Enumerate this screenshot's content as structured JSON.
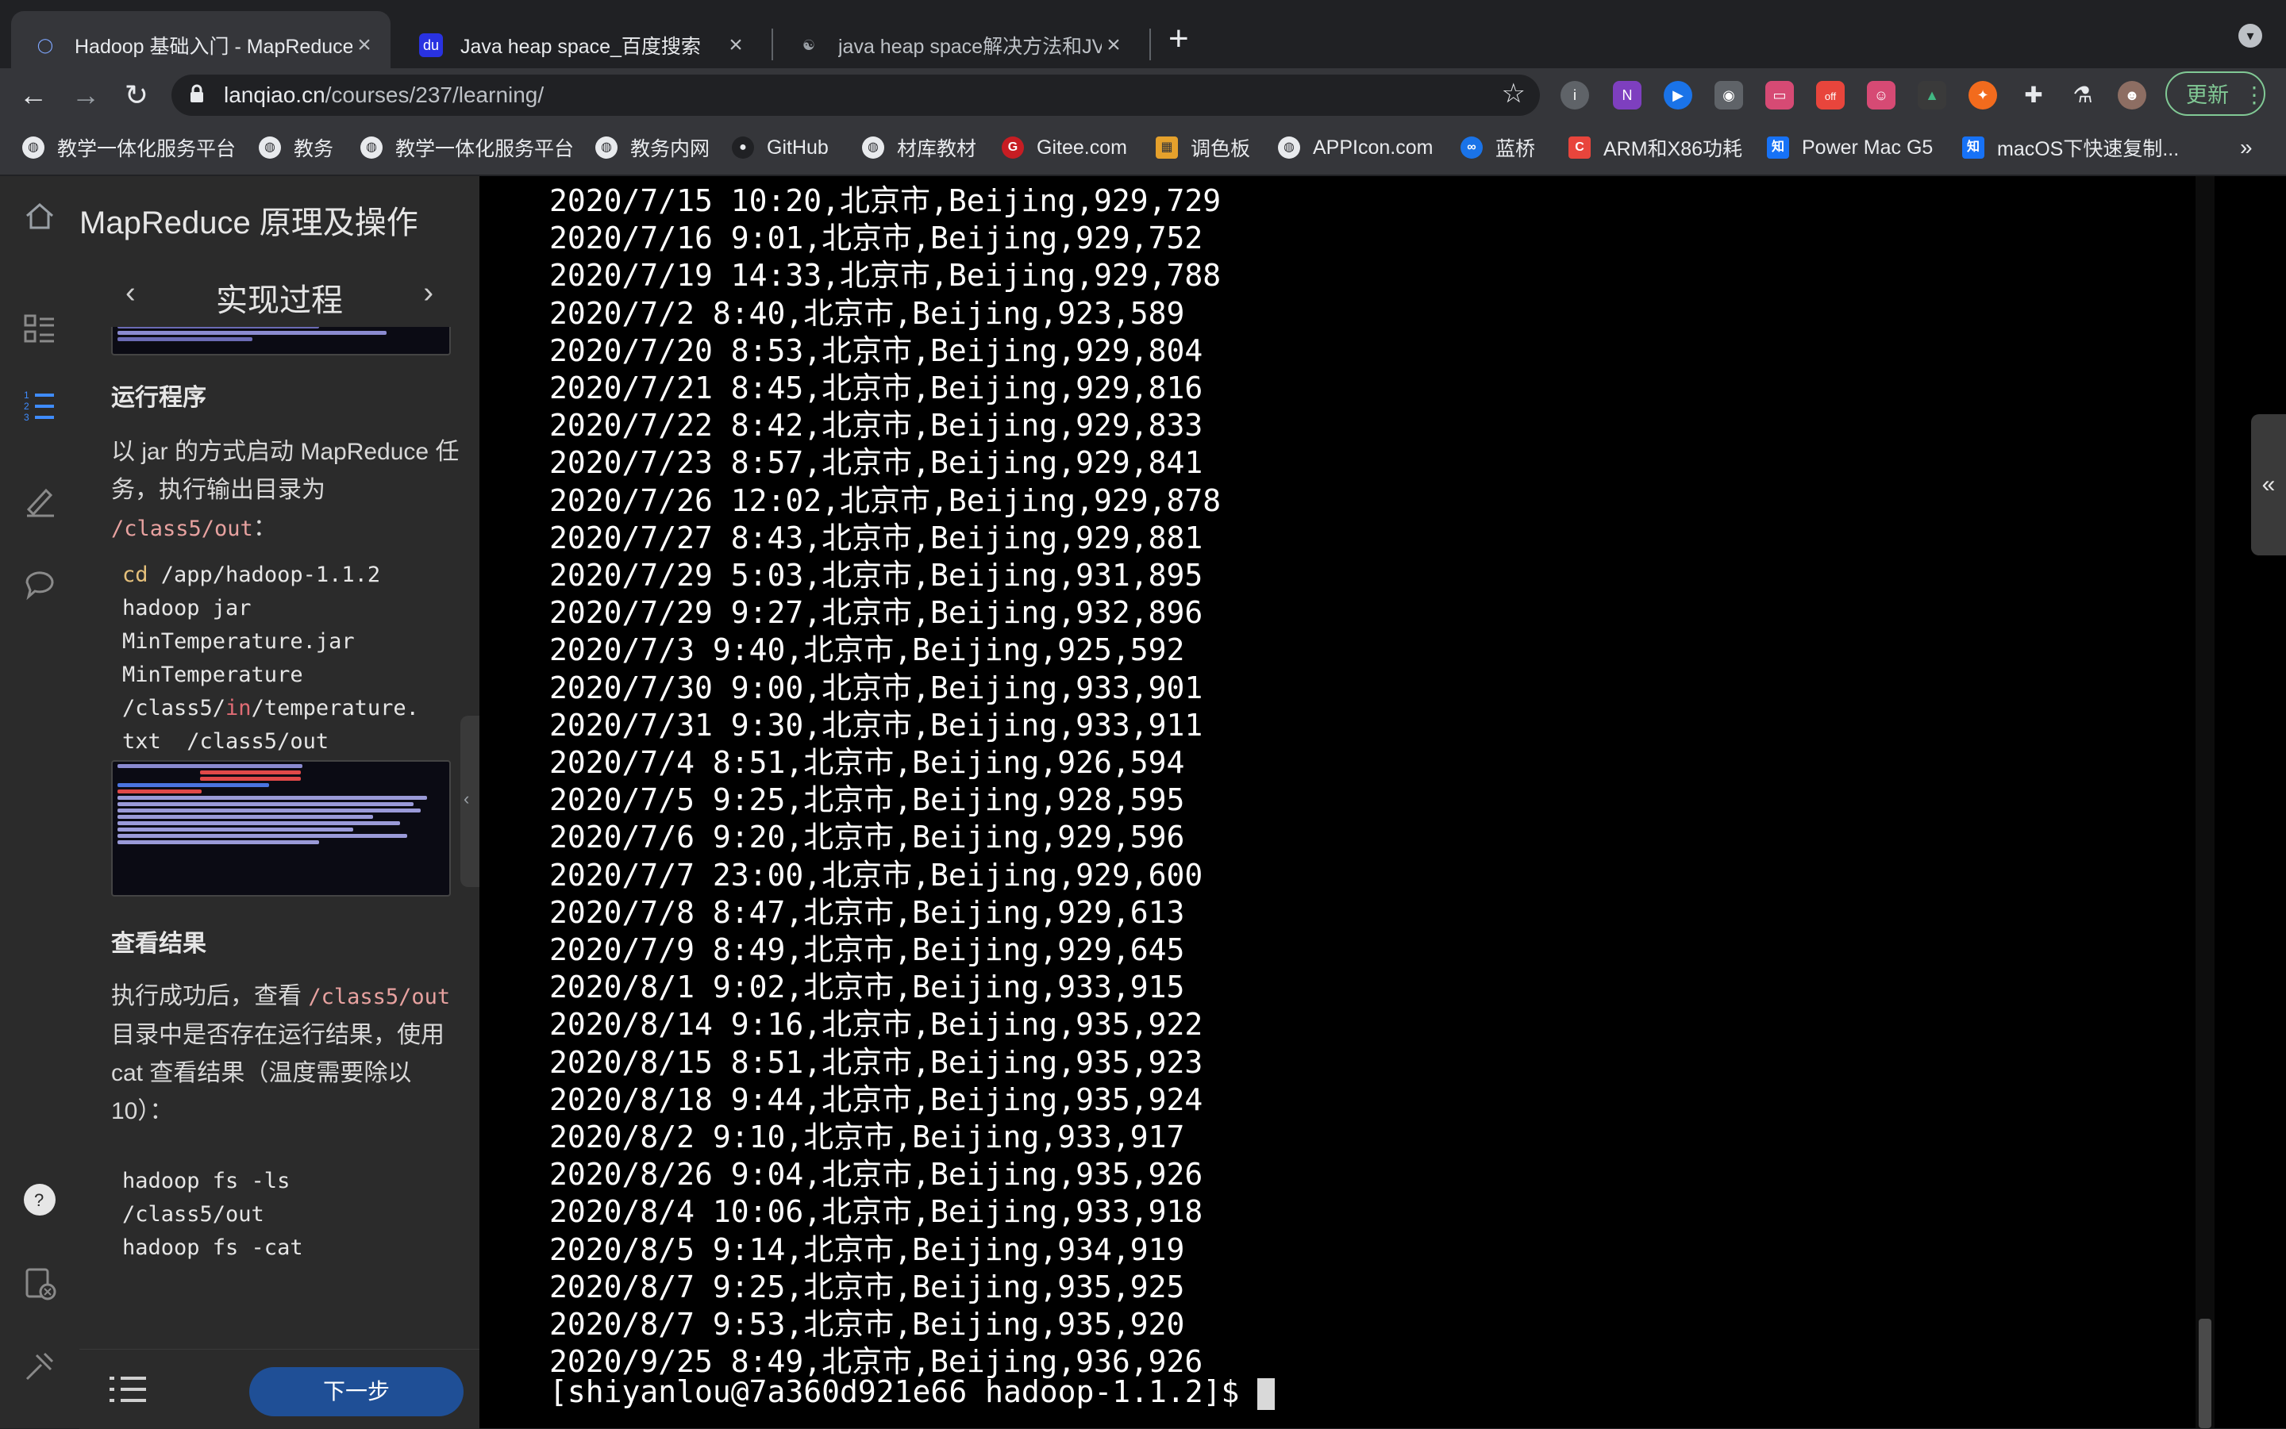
{
  "tabs": [
    {
      "title": "Hadoop 基础入门 - MapReduce",
      "active": true
    },
    {
      "title": "Java heap space_百度搜索",
      "active": false
    },
    {
      "title": "java heap space解决方法和JVM",
      "active": false
    }
  ],
  "toolbar": {
    "url_host": "lanqiao.cn",
    "url_path": "/courses/237/learning/",
    "update_label": "更新",
    "ext_badge": "off"
  },
  "bookmarks": [
    "教学一体化服务平台",
    "教务",
    "教学一体化服务平台",
    "教务内网",
    "GitHub",
    "材库教材",
    "Gitee.com",
    "调色板",
    "APPIcon.com",
    "蓝桥",
    "ARM和X86功耗",
    "Power Mac G5",
    "macOS下快速复制..."
  ],
  "bookmarks_more": "»",
  "course": {
    "title": "MapReduce 原理及操作",
    "section_title": "实现过程",
    "h_run": "运行程序",
    "run_para_1": "以 jar 的方式启动 MapReduce 任务，执行输出目录为 ",
    "run_para_code": "/class5/out",
    "run_para_2": "：",
    "code_cd": "cd",
    "code1": " /app/hadoop-1.1.2\nhadoop jar\nMinTemperature.jar\nMinTemperature\n/class5/",
    "code1_in": "in",
    "code1_tail": "/temperature.\ntxt  /class5/out",
    "h_result": "查看结果",
    "result_para_1": "执行成功后，查看 ",
    "result_para_code": "/class5/out",
    "result_para_2": " 目录中是否存在运行结果，使用 cat 查看结果（温度需要除以 10）：",
    "code2": "hadoop fs -ls\n/class5/out\nhadoop fs -cat",
    "next_label": "下一步"
  },
  "terminal": {
    "lines": [
      "2020/7/15 10:20,北京市,Beijing,929,729",
      "2020/7/16 9:01,北京市,Beijing,929,752",
      "2020/7/19 14:33,北京市,Beijing,929,788",
      "2020/7/2 8:40,北京市,Beijing,923,589",
      "2020/7/20 8:53,北京市,Beijing,929,804",
      "2020/7/21 8:45,北京市,Beijing,929,816",
      "2020/7/22 8:42,北京市,Beijing,929,833",
      "2020/7/23 8:57,北京市,Beijing,929,841",
      "2020/7/26 12:02,北京市,Beijing,929,878",
      "2020/7/27 8:43,北京市,Beijing,929,881",
      "2020/7/29 5:03,北京市,Beijing,931,895",
      "2020/7/29 9:27,北京市,Beijing,932,896",
      "2020/7/3 9:40,北京市,Beijing,925,592",
      "2020/7/30 9:00,北京市,Beijing,933,901",
      "2020/7/31 9:30,北京市,Beijing,933,911",
      "2020/7/4 8:51,北京市,Beijing,926,594",
      "2020/7/5 9:25,北京市,Beijing,928,595",
      "2020/7/6 9:20,北京市,Beijing,929,596",
      "2020/7/7 23:00,北京市,Beijing,929,600",
      "2020/7/8 8:47,北京市,Beijing,929,613",
      "2020/7/9 8:49,北京市,Beijing,929,645",
      "2020/8/1 9:02,北京市,Beijing,933,915",
      "2020/8/14 9:16,北京市,Beijing,935,922",
      "2020/8/15 8:51,北京市,Beijing,935,923",
      "2020/8/18 9:44,北京市,Beijing,935,924",
      "2020/8/2 9:10,北京市,Beijing,933,917",
      "2020/8/26 9:04,北京市,Beijing,935,926",
      "2020/8/4 10:06,北京市,Beijing,933,918",
      "2020/8/5 9:14,北京市,Beijing,934,919",
      "2020/8/7 9:25,北京市,Beijing,935,925",
      "2020/8/7 9:53,北京市,Beijing,935,920",
      "2020/9/25 8:49,北京市,Beijing,936,926"
    ],
    "prompt": "[shiyanlou@7a360d921e66 hadoop-1.1.2]$ "
  }
}
